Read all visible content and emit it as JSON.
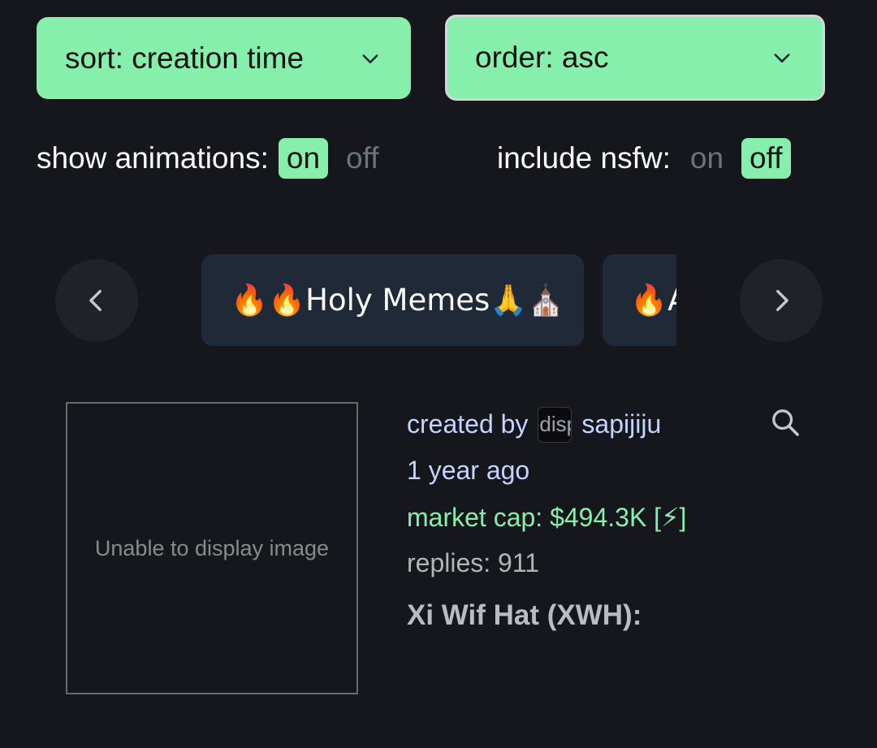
{
  "filters": {
    "sort_label": "sort: creation time",
    "order_label": "order: asc",
    "animations": {
      "label": "show animations:",
      "on": "on",
      "off": "off",
      "selected": "on"
    },
    "nsfw": {
      "label": "include nsfw:",
      "on": "on",
      "off": "off",
      "selected": "off"
    }
  },
  "carousel": {
    "chips": [
      {
        "label": "🔥🔥Holy Memes🙏⛪"
      },
      {
        "label": "🔥A"
      }
    ]
  },
  "token": {
    "image_fallback": "Unable to display image",
    "created_by_prefix": "created by",
    "avatar_alt": "disp",
    "creator": "sapijiju",
    "age": "1 year ago",
    "market_cap": "market cap: $494.3K [⚡]",
    "replies": "replies: 911",
    "title": "Xi Wif Hat (XWH):"
  },
  "colors": {
    "accent": "#86efac",
    "background": "#16171c",
    "chip_bg": "#1f2937",
    "link": "#c7d2fe"
  },
  "icons": {
    "dropdown": "chevron-down-icon",
    "prev": "chevron-left-icon",
    "next": "chevron-right-icon",
    "search": "search-icon"
  }
}
